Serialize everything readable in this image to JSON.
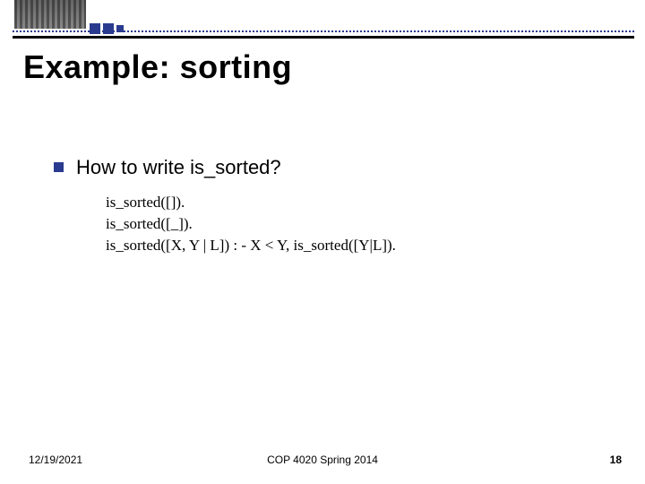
{
  "title": "Example: sorting",
  "bullet": {
    "text": "How to write is_sorted?"
  },
  "code": {
    "line1": "is_sorted([]).",
    "line2": "is_sorted([_]).",
    "line3": "is_sorted([X, Y | L]) : - X < Y, is_sorted([Y|L])."
  },
  "footer": {
    "date": "12/19/2021",
    "center": "COP 4020 Spring 2014",
    "page": "18"
  }
}
